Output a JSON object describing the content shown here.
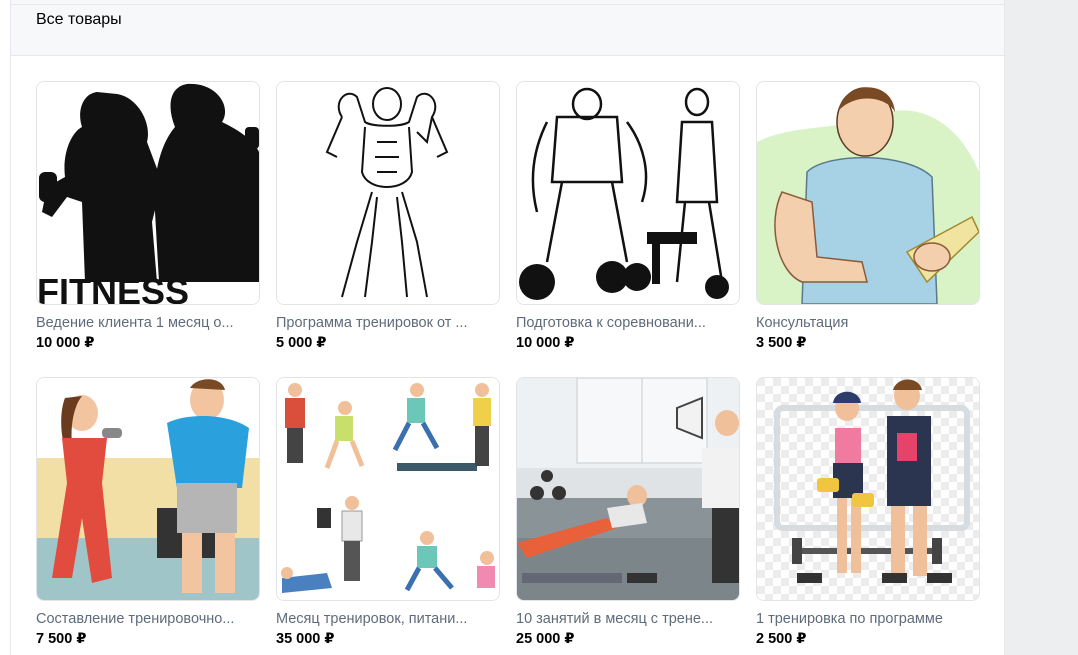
{
  "section": {
    "title": "Все товары"
  },
  "products": [
    {
      "title": "Ведение клиента 1 месяц о...",
      "price": "10 000 ₽",
      "image": "fitness-silhouette-image",
      "image_text": "FITNESS"
    },
    {
      "title": "Программа тренировок от ...",
      "price": "5 000 ₽",
      "image": "bodybuilder-sketch-image"
    },
    {
      "title": "Подготовка к соревновани...",
      "price": "10 000 ₽",
      "image": "competition-bodybuilders-image"
    },
    {
      "title": "Консультация",
      "price": "3 500 ₽",
      "image": "trainer-clipboard-image"
    },
    {
      "title": "Составление тренировочно...",
      "price": "7 500 ₽",
      "image": "gym-couple-image"
    },
    {
      "title": "Месяц тренировок, питани...",
      "price": "35 000 ₽",
      "image": "workout-people-image"
    },
    {
      "title": "10 занятий в месяц с трене...",
      "price": "25 000 ₽",
      "image": "coach-plank-image"
    },
    {
      "title": "1 тренировка по программе",
      "price": "2 500 ₽",
      "image": "trainer-client-image"
    }
  ],
  "colors": {
    "header_bg": "#f7f8fa",
    "title_gray": "#5f6b7a",
    "border": "#e3e4e8"
  }
}
